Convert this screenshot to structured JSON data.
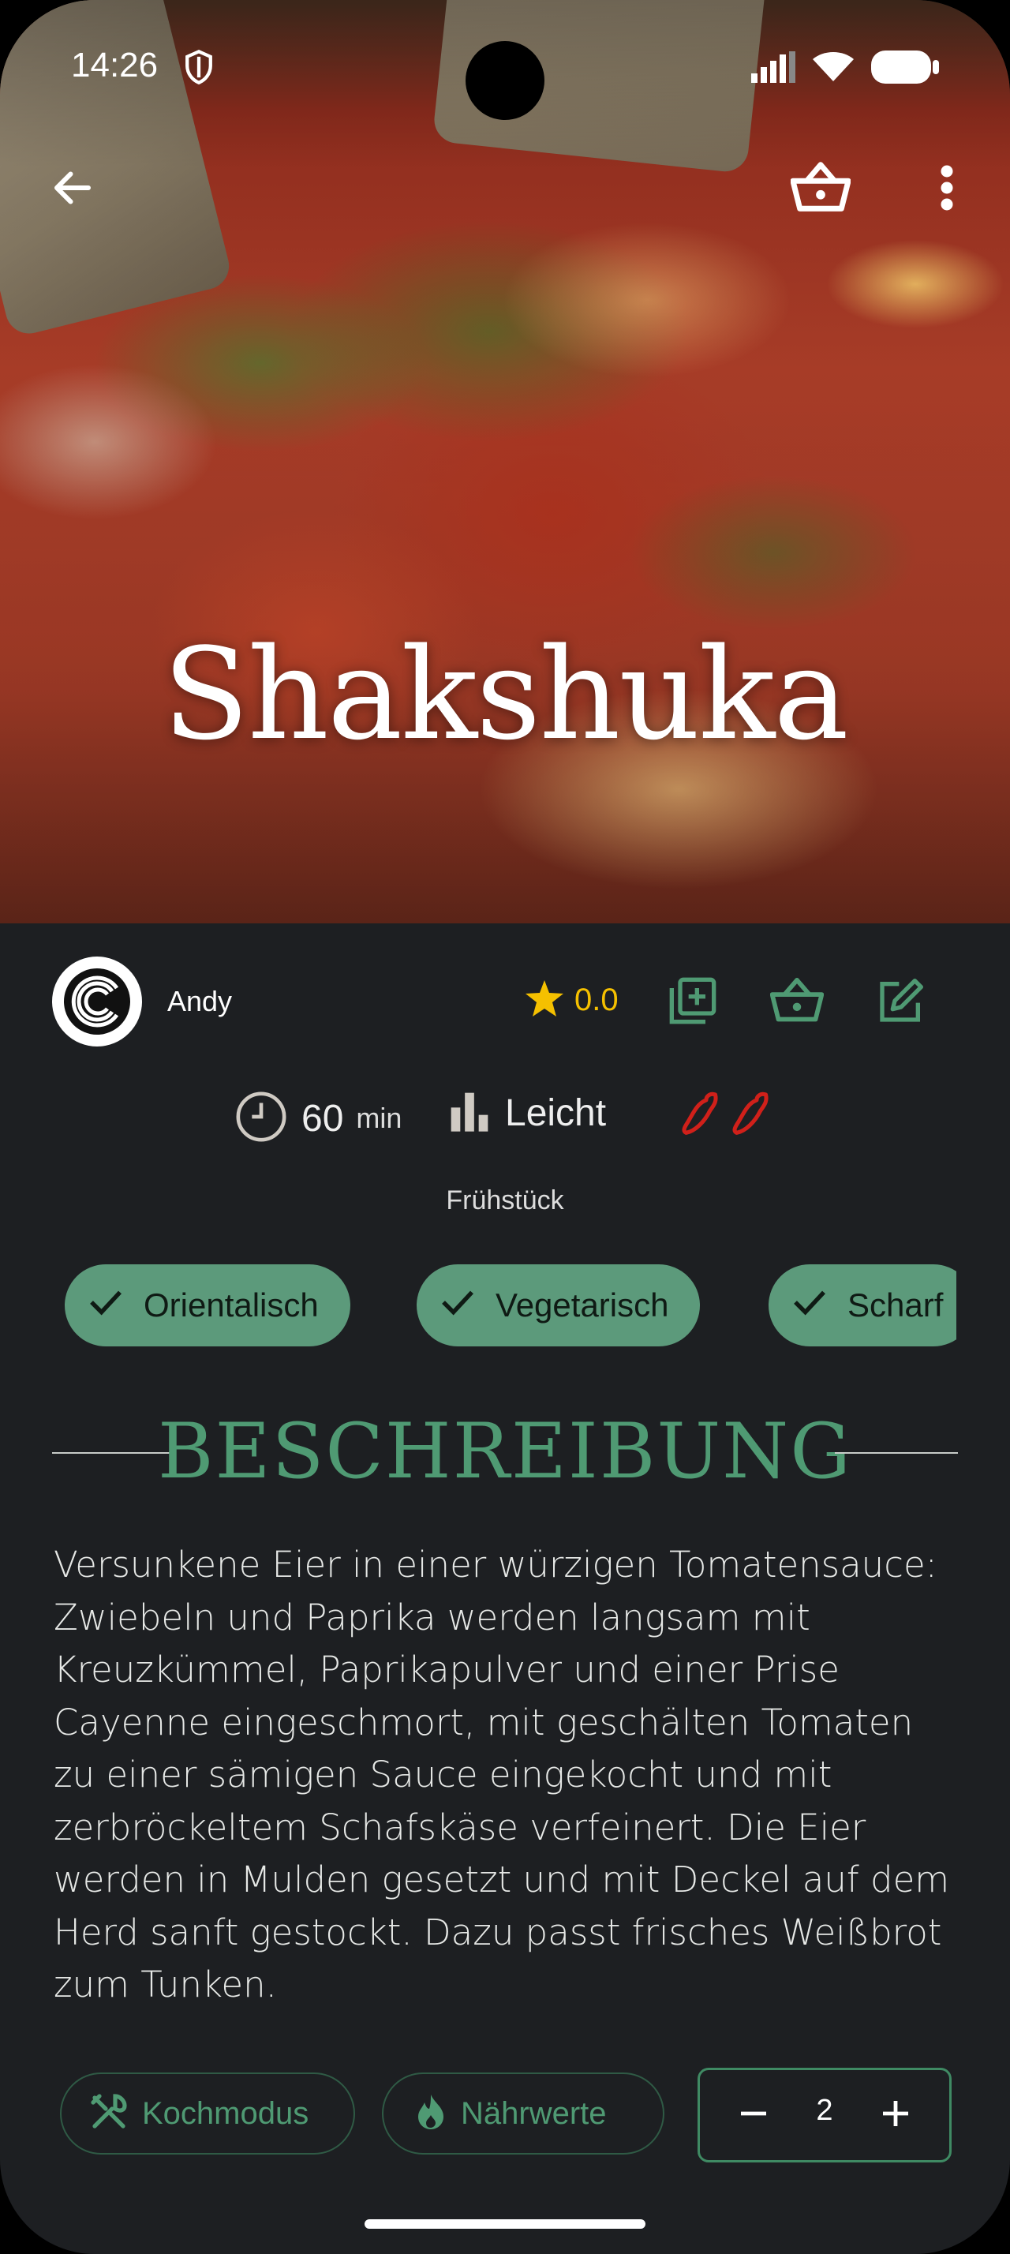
{
  "status_bar": {
    "time": "14:26"
  },
  "recipe": {
    "title": "Shakshuka",
    "author": "Andy",
    "rating": "0.0",
    "time_value": "60",
    "time_unit": "min",
    "difficulty": "Leicht",
    "spiciness_level": 2,
    "category": "Frühstück",
    "tags": [
      "Orientalisch",
      "Vegetarisch",
      "Scharf"
    ],
    "section_title": "BESCHREIBUNG",
    "description": "Versunkene Eier in einer würzigen Tomatensauce: Zwiebeln und Paprika werden langsam mit Kreuzkümmel, Paprikapulver und einer Prise Cayenne eingeschmort, mit geschälten Tomaten zu einer sämigen Sauce eingekocht und mit zerbröckeltem Schafskäse verfeinert. Die Eier werden in Mulden gesetzt und mit Deckel auf dem Herd sanft gestockt. Dazu passt frisches Weißbrot zum Tunken."
  },
  "actions": {
    "cook_mode": "Kochmodus",
    "nutrition": "Nährwerte",
    "servings": "2"
  },
  "icons": {
    "back": "arrow-left-icon",
    "basket": "basket-icon",
    "menu": "more-vert-icon",
    "star": "star-icon",
    "add_collection": "add-box-icon",
    "shopping": "basket-icon",
    "edit": "edit-icon",
    "clock": "clock-icon",
    "difficulty": "bar-chart-icon",
    "chili": "chili-icon",
    "check": "check-icon",
    "utensils": "utensils-icon",
    "flame": "flame-icon",
    "minus": "minus-icon",
    "plus": "plus-icon"
  },
  "colors": {
    "background": "#1d1f22",
    "accent": "#4f9a73",
    "chip": "#5c9a7b",
    "star": "#f5c000",
    "chili": "#d0201a"
  }
}
